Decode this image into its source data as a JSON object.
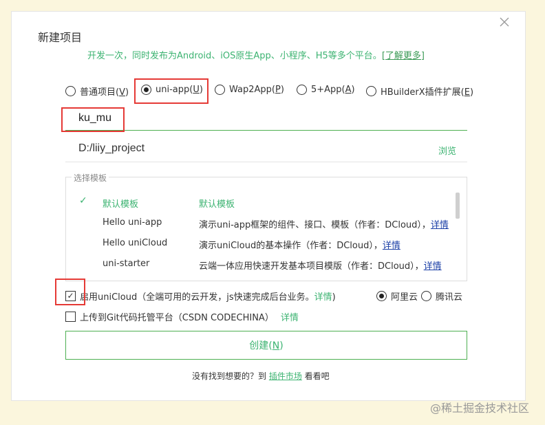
{
  "dialog": {
    "title": "新建项目",
    "subtitle": "开发一次，同时发布为Android、iOS原生App、小程序、H5等多个平台。",
    "learn_more": "[了解更多]"
  },
  "project_types": [
    {
      "label": "普通项目(",
      "key": "V",
      "suffix": ")",
      "checked": false
    },
    {
      "label": "uni-app(",
      "key": "U",
      "suffix": ")",
      "checked": true
    },
    {
      "label": "Wap2App(",
      "key": "P",
      "suffix": ")",
      "checked": false
    },
    {
      "label": "5+App(",
      "key": "A",
      "suffix": ")",
      "checked": false
    },
    {
      "label": "HBuilderX插件扩展(",
      "key": "E",
      "suffix": ")",
      "checked": false
    }
  ],
  "name_input": {
    "value": "ku_mu"
  },
  "path": {
    "value": "D:/liiy_project",
    "browse_label": "浏览"
  },
  "templates": {
    "legend": "选择模板",
    "rows": [
      {
        "name": "默认模板",
        "desc": "默认模板",
        "detail": "",
        "selected": true
      },
      {
        "name": "Hello uni-app",
        "desc": "演示uni-app框架的组件、接口、模板（作者：DCloud），",
        "detail": "详情",
        "selected": false
      },
      {
        "name": "Hello uniCloud",
        "desc": "演示uniCloud的基本操作（作者：DCloud），",
        "detail": "详情",
        "selected": false
      },
      {
        "name": "uni-starter",
        "desc": "云端一体应用快速开发基本项目模版（作者：DCloud），",
        "detail": "详情",
        "selected": false
      }
    ]
  },
  "unicloud": {
    "checked": true,
    "label": "启用uniCloud（全端可用的云开发，js快速完成后台业务。",
    "detail": "详情",
    "close_paren": ")",
    "providers": [
      {
        "label": "阿里云",
        "checked": true
      },
      {
        "label": "腾讯云",
        "checked": false
      }
    ]
  },
  "git": {
    "checked": false,
    "label": "上传到Git代码托管平台（CSDN CODECHINA）",
    "detail": "详情"
  },
  "create_button": {
    "label": "创建(",
    "key": "N",
    "suffix": ")"
  },
  "footer": {
    "prefix": "没有找到想要的？到 ",
    "link": "插件市场",
    "suffix": " 看看吧"
  },
  "watermark": "@稀土掘金技术社区",
  "colors": {
    "accent": "#3cb371",
    "highlight": "#e53935",
    "link": "#1a3ea6",
    "background": "#fbf6dd"
  }
}
